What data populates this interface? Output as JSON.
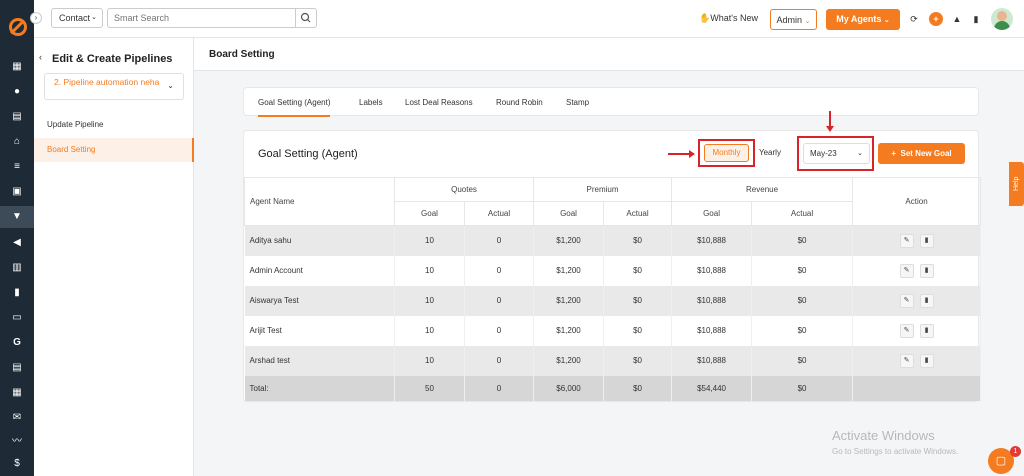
{
  "rail": {
    "icons": [
      "dashboard-icon",
      "contacts-icon",
      "documents-icon",
      "bank-icon",
      "list-icon",
      "contact-card-icon",
      "pipeline-icon",
      "megaphone-icon",
      "report-icon",
      "chart-icon",
      "folder-icon",
      "google-icon",
      "notes-icon",
      "calendar-icon",
      "mail-icon",
      "signature-icon",
      "dollar-icon"
    ]
  },
  "topbar": {
    "contact_select": "Contact",
    "search_placeholder": "Smart Search",
    "whats_new": "What's New",
    "role_select": "Admin",
    "my_agents": "My Agents",
    "colors": {
      "accent": "#f47b20"
    }
  },
  "sidebar": {
    "title": "Edit & Create Pipelines",
    "pipeline_select": "2. Pipeline automation neha",
    "items": [
      {
        "label": "Update Pipeline",
        "active": false
      },
      {
        "label": "Board Setting",
        "active": true
      }
    ]
  },
  "page": {
    "title": "Board Setting"
  },
  "tabs": [
    "Goal Setting (Agent)",
    "Labels",
    "Lost Deal Reasons",
    "Round Robin",
    "Stamp"
  ],
  "card": {
    "title": "Goal Setting (Agent)",
    "monthly": "Monthly",
    "yearly": "Yearly",
    "month_select": "May-23",
    "set_goal": "Set New Goal"
  },
  "table": {
    "agent_header": "Agent Name",
    "groups": [
      "Quotes",
      "Premium",
      "Revenue"
    ],
    "sub": [
      "Goal",
      "Actual"
    ],
    "action_header": "Action",
    "rows": [
      {
        "name": "Aditya sahu",
        "q_goal": "10",
        "q_actual": "0",
        "p_goal": "$1,200",
        "p_actual": "$0",
        "r_goal": "$10,888",
        "r_actual": "$0"
      },
      {
        "name": "Admin Account",
        "q_goal": "10",
        "q_actual": "0",
        "p_goal": "$1,200",
        "p_actual": "$0",
        "r_goal": "$10,888",
        "r_actual": "$0"
      },
      {
        "name": "Aiswarya Test",
        "q_goal": "10",
        "q_actual": "0",
        "p_goal": "$1,200",
        "p_actual": "$0",
        "r_goal": "$10,888",
        "r_actual": "$0"
      },
      {
        "name": "Arijit Test",
        "q_goal": "10",
        "q_actual": "0",
        "p_goal": "$1,200",
        "p_actual": "$0",
        "r_goal": "$10,888",
        "r_actual": "$0"
      },
      {
        "name": "Arshad test",
        "q_goal": "10",
        "q_actual": "0",
        "p_goal": "$1,200",
        "p_actual": "$0",
        "r_goal": "$10,888",
        "r_actual": "$0"
      }
    ],
    "total": {
      "name": "Total:",
      "q_goal": "50",
      "q_actual": "0",
      "p_goal": "$6,000",
      "p_actual": "$0",
      "r_goal": "$54,440",
      "r_actual": "$0"
    }
  },
  "help": "Help",
  "windows": {
    "line1": "Activate Windows",
    "line2": "Go to Settings to activate Windows."
  },
  "chat_badge": "1"
}
